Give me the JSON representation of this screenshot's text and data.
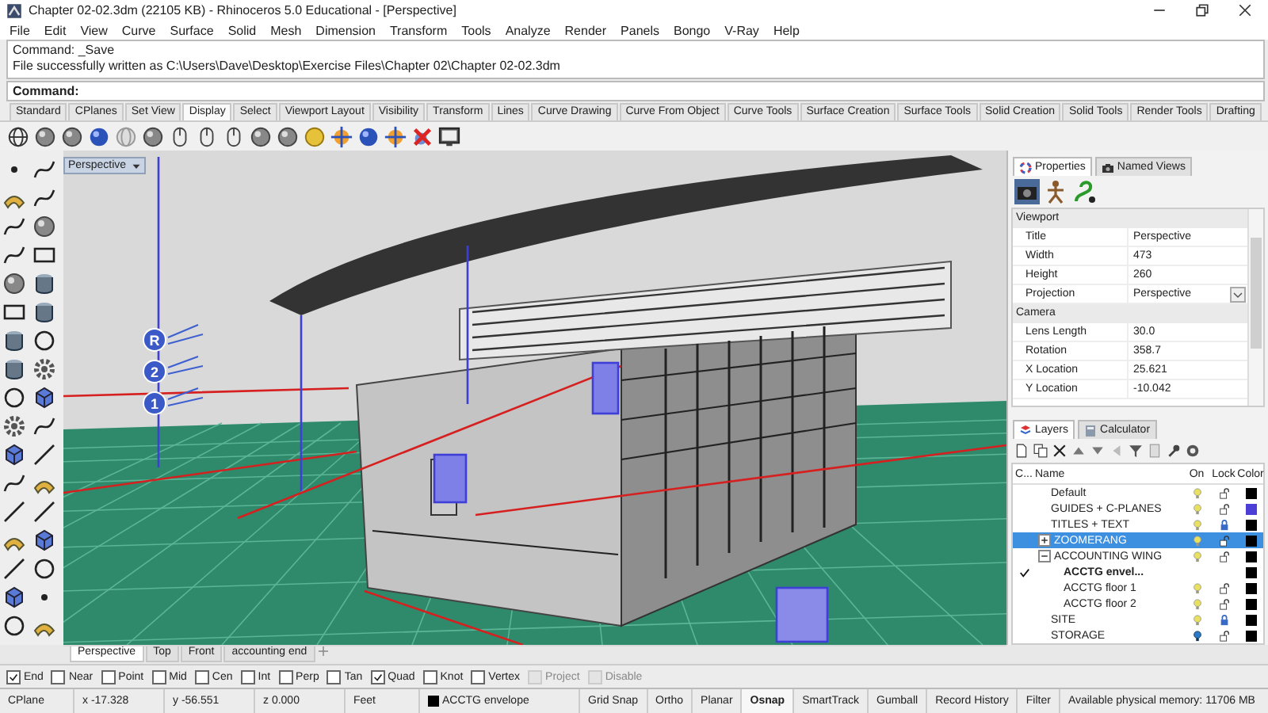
{
  "window": {
    "title": "Chapter 02-02.3dm (22105 KB) - Rhinoceros 5.0 Educational - [Perspective]"
  },
  "menu": [
    "File",
    "Edit",
    "View",
    "Curve",
    "Surface",
    "Solid",
    "Mesh",
    "Dimension",
    "Transform",
    "Tools",
    "Analyze",
    "Render",
    "Panels",
    "Bongo",
    "V-Ray",
    "Help"
  ],
  "command_history": [
    "Command: _Save",
    "File successfully written as C:\\Users\\Dave\\Desktop\\Exercise Files\\Chapter 02\\Chapter 02-02.3dm"
  ],
  "command_prompt": "Command:",
  "toolbar_tabs": [
    {
      "label": "Standard",
      "selected": false
    },
    {
      "label": "CPlanes",
      "selected": false
    },
    {
      "label": "Set View",
      "selected": false
    },
    {
      "label": "Display",
      "selected": true
    },
    {
      "label": "Select",
      "selected": false
    },
    {
      "label": "Viewport Layout",
      "selected": false
    },
    {
      "label": "Visibility",
      "selected": false
    },
    {
      "label": "Transform",
      "selected": false
    },
    {
      "label": "Lines",
      "selected": false
    },
    {
      "label": "Curve Drawing",
      "selected": false
    },
    {
      "label": "Curve From Object",
      "selected": false
    },
    {
      "label": "Curve Tools",
      "selected": false
    },
    {
      "label": "Surface Creation",
      "selected": false
    },
    {
      "label": "Surface Tools",
      "selected": false
    },
    {
      "label": "Solid Creation",
      "selected": false
    },
    {
      "label": "Solid Tools",
      "selected": false
    },
    {
      "label": "Render Tools",
      "selected": false
    },
    {
      "label": "Drafting",
      "selected": false
    }
  ],
  "viewport": {
    "label": "Perspective",
    "markers": [
      "R",
      "2",
      "1"
    ]
  },
  "viewport_tabs": [
    {
      "label": "Perspective",
      "selected": true
    },
    {
      "label": "Top",
      "selected": false
    },
    {
      "label": "Front",
      "selected": false
    },
    {
      "label": "accounting end",
      "selected": false
    }
  ],
  "properties_panel": {
    "tabs": [
      {
        "label": "Properties",
        "selected": true
      },
      {
        "label": "Named Views",
        "selected": false
      }
    ],
    "sections": [
      {
        "title": "Viewport",
        "rows": [
          {
            "label": "Title",
            "value": "Perspective",
            "kind": "text"
          },
          {
            "label": "Width",
            "value": "473",
            "kind": "text"
          },
          {
            "label": "Height",
            "value": "260",
            "kind": "text"
          },
          {
            "label": "Projection",
            "value": "Perspective",
            "kind": "dropdown"
          }
        ]
      },
      {
        "title": "Camera",
        "rows": [
          {
            "label": "Lens Length",
            "value": "30.0",
            "kind": "text"
          },
          {
            "label": "Rotation",
            "value": "358.7",
            "kind": "text"
          },
          {
            "label": "X Location",
            "value": "25.621",
            "kind": "text"
          },
          {
            "label": "Y Location",
            "value": "-10.042",
            "kind": "text"
          }
        ]
      }
    ]
  },
  "layers_panel": {
    "tabs": [
      {
        "label": "Layers",
        "selected": true
      },
      {
        "label": "Calculator",
        "selected": false
      }
    ],
    "columns": [
      "C...",
      "Name",
      "On",
      "Lock",
      "Color"
    ],
    "layers": [
      {
        "name": "Default",
        "current": false,
        "on": true,
        "locked": false,
        "color": "#000000",
        "selected": false
      },
      {
        "name": "GUIDES + C-PLANES",
        "current": false,
        "on": true,
        "locked": false,
        "color": "#4b3fd6",
        "selected": false
      },
      {
        "name": "TITLES + TEXT",
        "current": false,
        "on": true,
        "locked": true,
        "color": "#000000",
        "selected": false
      },
      {
        "name": "ZOOMERANG",
        "current": false,
        "on": true,
        "locked": false,
        "color": "#000000",
        "selected": true,
        "expanded": false
      },
      {
        "name": "ACCOUNTING WING",
        "current": false,
        "on": true,
        "locked": false,
        "color": "#000000",
        "selected": false,
        "expanded": true,
        "children": [
          {
            "name": "ACCTG envel...",
            "current": true,
            "color": "#000000",
            "selected": false
          },
          {
            "name": "ACCTG floor 1",
            "current": false,
            "on": true,
            "locked": false,
            "color": "#000000",
            "selected": false
          },
          {
            "name": "ACCTG floor 2",
            "current": false,
            "on": true,
            "locked": false,
            "color": "#000000",
            "selected": false
          }
        ]
      },
      {
        "name": "SITE",
        "current": false,
        "on": true,
        "locked": true,
        "color": "#000000",
        "selected": false
      },
      {
        "name": "STORAGE",
        "current": false,
        "on": false,
        "locked": false,
        "color": "#000000",
        "selected": false
      }
    ]
  },
  "osnaps": [
    {
      "label": "End",
      "checked": true,
      "disabled": false
    },
    {
      "label": "Near",
      "checked": false,
      "disabled": false
    },
    {
      "label": "Point",
      "checked": false,
      "disabled": false
    },
    {
      "label": "Mid",
      "checked": false,
      "disabled": false
    },
    {
      "label": "Cen",
      "checked": false,
      "disabled": false
    },
    {
      "label": "Int",
      "checked": false,
      "disabled": false
    },
    {
      "label": "Perp",
      "checked": false,
      "disabled": false
    },
    {
      "label": "Tan",
      "checked": false,
      "disabled": false
    },
    {
      "label": "Quad",
      "checked": true,
      "disabled": false
    },
    {
      "label": "Knot",
      "checked": false,
      "disabled": false
    },
    {
      "label": "Vertex",
      "checked": false,
      "disabled": false
    },
    {
      "label": "Project",
      "checked": false,
      "disabled": true
    },
    {
      "label": "Disable",
      "checked": false,
      "disabled": true
    }
  ],
  "status_bar": {
    "cplane": "CPlane",
    "x": "x -17.328",
    "y": "y -56.551",
    "z": "z 0.000",
    "units": "Feet",
    "layer": {
      "name": "ACCTG envelope",
      "color": "#000000"
    },
    "toggles": [
      {
        "label": "Grid Snap",
        "on": false
      },
      {
        "label": "Ortho",
        "on": false
      },
      {
        "label": "Planar",
        "on": false
      },
      {
        "label": "Osnap",
        "on": true
      },
      {
        "label": "SmartTrack",
        "on": false
      },
      {
        "label": "Gumball",
        "on": false
      },
      {
        "label": "Record History",
        "on": false
      },
      {
        "label": "Filter",
        "on": false
      }
    ],
    "memory": "Available physical memory: 11706 MB"
  }
}
